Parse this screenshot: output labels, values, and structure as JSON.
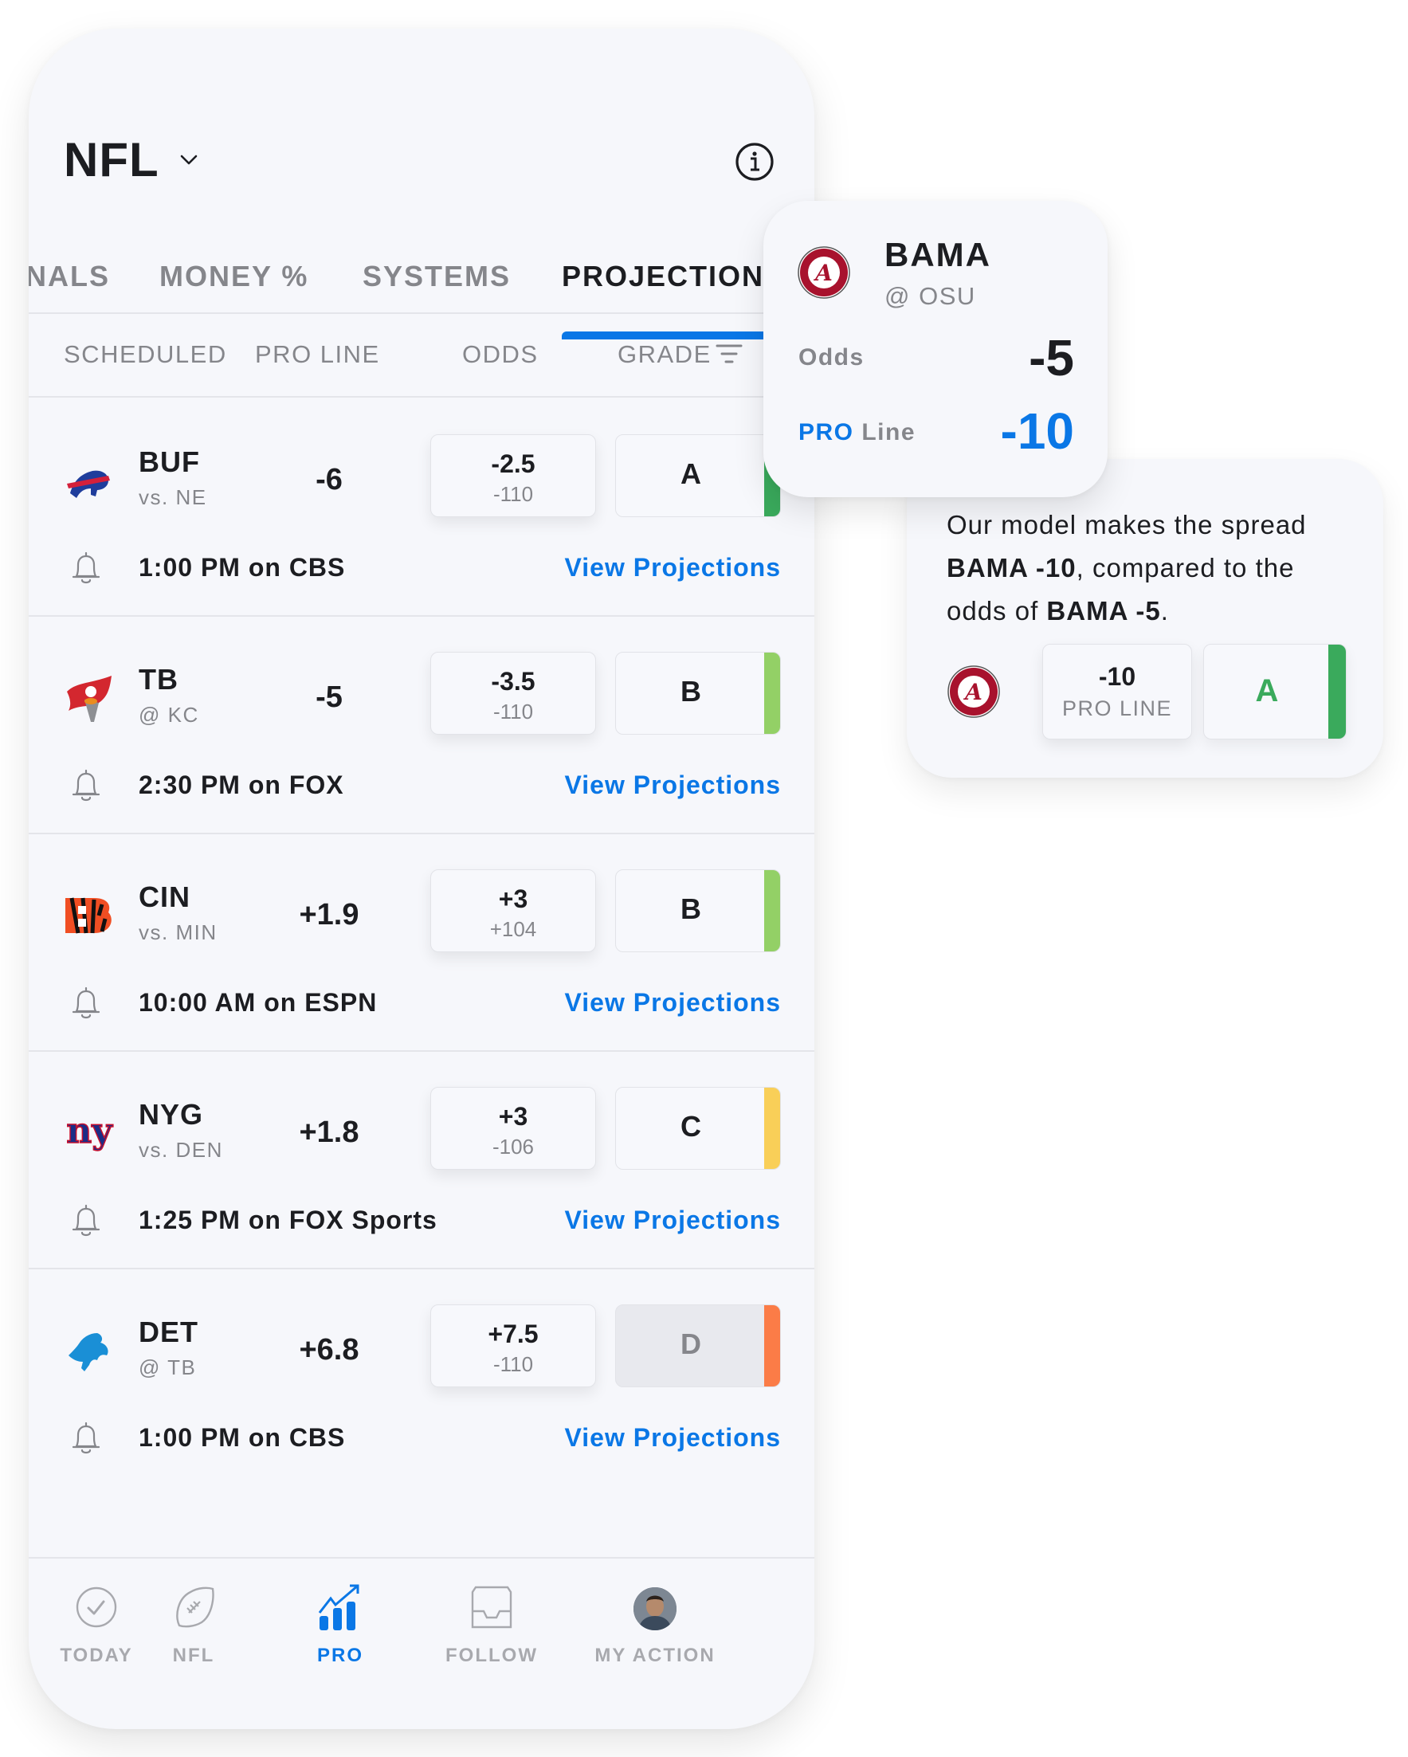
{
  "header": {
    "title": "NFL",
    "dropdown_icon": "chevron-down-icon",
    "info_icon": "info-icon"
  },
  "tabs": [
    {
      "label": "NALS",
      "active": false
    },
    {
      "label": "MONEY %",
      "active": false
    },
    {
      "label": "SYSTEMS",
      "active": false
    },
    {
      "label": "PROJECTIONS",
      "active": true
    }
  ],
  "columns": {
    "scheduled": "SCHEDULED",
    "pro_line": "PRO LINE",
    "odds": "ODDS",
    "grade": "GRADE",
    "filter_icon": "filter-icon"
  },
  "games": [
    {
      "team": "BUF",
      "opponent": "vs. NE",
      "pro_line": "-6",
      "odds": "-2.5",
      "odds_price": "-110",
      "grade": "A",
      "grade_color": "#3aaa5c",
      "dimmed": false,
      "time": "1:00 PM on CBS",
      "link": "View Projections",
      "logo": "bills-logo"
    },
    {
      "team": "TB",
      "opponent": "@ KC",
      "pro_line": "-5",
      "odds": "-3.5",
      "odds_price": "-110",
      "grade": "B",
      "grade_color": "#93d066",
      "dimmed": false,
      "time": "2:30 PM on FOX",
      "link": "View Projections",
      "logo": "buccaneers-logo"
    },
    {
      "team": "CIN",
      "opponent": "vs. MIN",
      "pro_line": "+1.9",
      "odds": "+3",
      "odds_price": "+104",
      "grade": "B",
      "grade_color": "#93d066",
      "dimmed": false,
      "time": "10:00 AM on ESPN",
      "link": "View Projections",
      "logo": "bengals-logo"
    },
    {
      "team": "NYG",
      "opponent": "vs. DEN",
      "pro_line": "+1.8",
      "odds": "+3",
      "odds_price": "-106",
      "grade": "C",
      "grade_color": "#f9cf58",
      "dimmed": false,
      "time": "1:25 PM on FOX Sports",
      "link": "View Projections",
      "logo": "giants-logo"
    },
    {
      "team": "DET",
      "opponent": "@ TB",
      "pro_line": "+6.8",
      "odds": "+7.5",
      "odds_price": "-110",
      "grade": "D",
      "grade_color": "#fb7c47",
      "dimmed": true,
      "time": "1:00 PM on CBS",
      "link": "View Projections",
      "logo": "lions-logo"
    }
  ],
  "bottom_nav": [
    {
      "label": "TODAY",
      "icon": "check-circle-icon",
      "active": false
    },
    {
      "label": "NFL",
      "icon": "football-icon",
      "active": false
    },
    {
      "label": "PRO",
      "icon": "chart-trend-icon",
      "active": true
    },
    {
      "label": "FOLLOW",
      "icon": "inbox-icon",
      "active": false
    },
    {
      "label": "MY ACTION",
      "icon": "avatar",
      "active": false
    }
  ],
  "popover": {
    "team": "BAMA",
    "opponent": "@ OSU",
    "odds_label": "Odds",
    "odds_value": "-5",
    "pro_label_1": "PRO",
    "pro_label_2": " Line",
    "pro_value": "-10"
  },
  "explanation": {
    "text_1": "Our model makes the spread ",
    "bold_1": "BAMA -10",
    "text_2": ", compared to the odds of ",
    "bold_2": "BAMA -5",
    "text_3": ".",
    "pro_value": "-10",
    "pro_label": "PRO LINE",
    "grade": "A"
  },
  "colors": {
    "accent": "#0a77e6",
    "grade_a": "#3aaa5c",
    "grade_b": "#93d066",
    "grade_c": "#f9cf58",
    "grade_d": "#fb7c47"
  }
}
